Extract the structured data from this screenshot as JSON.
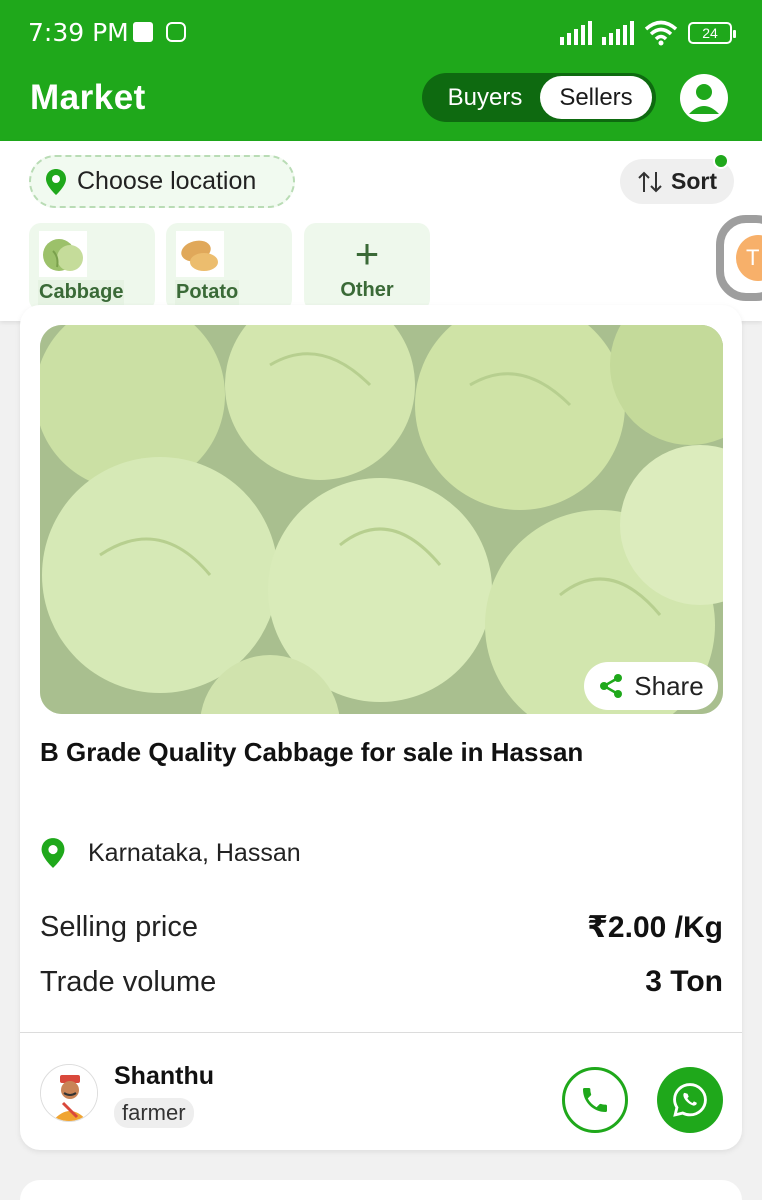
{
  "status_bar": {
    "time": "7:39 PM",
    "battery": "24"
  },
  "header": {
    "title": "Market",
    "toggle": {
      "buyers_label": "Buyers",
      "sellers_label": "Sellers",
      "selected": "Sellers"
    }
  },
  "filters": {
    "location_label": "Choose location",
    "sort_label": "Sort",
    "categories": [
      {
        "label": "Cabbage",
        "icon": "cabbage-icon"
      },
      {
        "label": "Potato",
        "icon": "potato-icon"
      },
      {
        "label": "Other",
        "icon": "plus-icon"
      }
    ]
  },
  "listing": {
    "share_label": "Share",
    "title": "B Grade Quality Cabbage for sale in Hassan",
    "location": "Karnataka, Hassan",
    "selling_price_label": "Selling price",
    "selling_price_value": "₹2.00 /Kg",
    "trade_volume_label": "Trade volume",
    "trade_volume_value": "3 Ton",
    "seller": {
      "name": "Shanthu",
      "role": "farmer"
    }
  },
  "colors": {
    "brand_green": "#1fa81b",
    "dark_green": "#0e6a10"
  }
}
